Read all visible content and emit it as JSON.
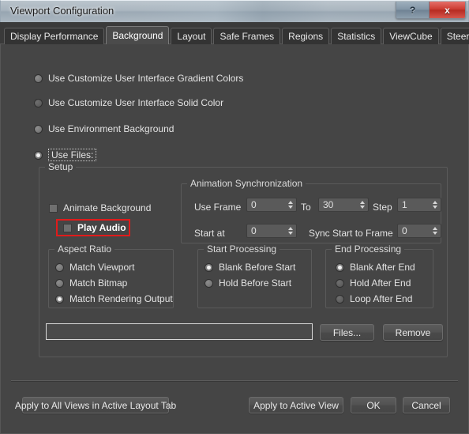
{
  "window": {
    "title": "Viewport Configuration",
    "help_button": "?",
    "close_button": "x"
  },
  "tabs": [
    {
      "label": "Display Performance",
      "active": false
    },
    {
      "label": "Background",
      "active": true
    },
    {
      "label": "Layout",
      "active": false
    },
    {
      "label": "Safe Frames",
      "active": false
    },
    {
      "label": "Regions",
      "active": false
    },
    {
      "label": "Statistics",
      "active": false
    },
    {
      "label": "ViewCube",
      "active": false
    },
    {
      "label": "SteeringWheels",
      "active": false
    }
  ],
  "background_source": {
    "options": [
      {
        "label": "Use Customize User Interface Gradient Colors",
        "selected": false
      },
      {
        "label": "Use Customize User Interface Solid Color",
        "selected": false
      },
      {
        "label": "Use Environment Background",
        "selected": false
      },
      {
        "label": "Use Files:",
        "selected": true,
        "focused": true
      }
    ]
  },
  "setup": {
    "legend": "Setup",
    "animate_background": {
      "label": "Animate Background",
      "checked": false
    },
    "play_audio": {
      "label": "Play Audio",
      "checked": false,
      "highlighted": true
    }
  },
  "animation_sync": {
    "legend": "Animation Synchronization",
    "use_frame_label": "Use Frame",
    "use_frame_value": "0",
    "to_label": "To",
    "to_value": "30",
    "step_label": "Step",
    "step_value": "1",
    "start_at_label": "Start at",
    "start_at_value": "0",
    "sync_start_label": "Sync Start to Frame",
    "sync_start_value": "0"
  },
  "aspect_ratio": {
    "legend": "Aspect Ratio",
    "options": [
      {
        "label": "Match Viewport",
        "selected": false
      },
      {
        "label": "Match Bitmap",
        "selected": false
      },
      {
        "label": "Match Rendering Output",
        "selected": true
      }
    ]
  },
  "start_processing": {
    "legend": "Start Processing",
    "options": [
      {
        "label": "Blank Before Start",
        "selected": true
      },
      {
        "label": "Hold Before Start",
        "selected": false
      }
    ]
  },
  "end_processing": {
    "legend": "End Processing",
    "options": [
      {
        "label": "Blank After End",
        "selected": true
      },
      {
        "label": "Hold After End",
        "selected": false
      },
      {
        "label": "Loop After End",
        "selected": false
      }
    ]
  },
  "file_row": {
    "path_value": "",
    "files_button": "Files...",
    "remove_button": "Remove"
  },
  "footer": {
    "apply_all_views": "Apply to All Views in Active Layout Tab",
    "apply_active_view": "Apply to Active View",
    "ok": "OK",
    "cancel": "Cancel"
  },
  "annotation": {
    "color": "#e01b1b",
    "target": "Play Audio"
  }
}
